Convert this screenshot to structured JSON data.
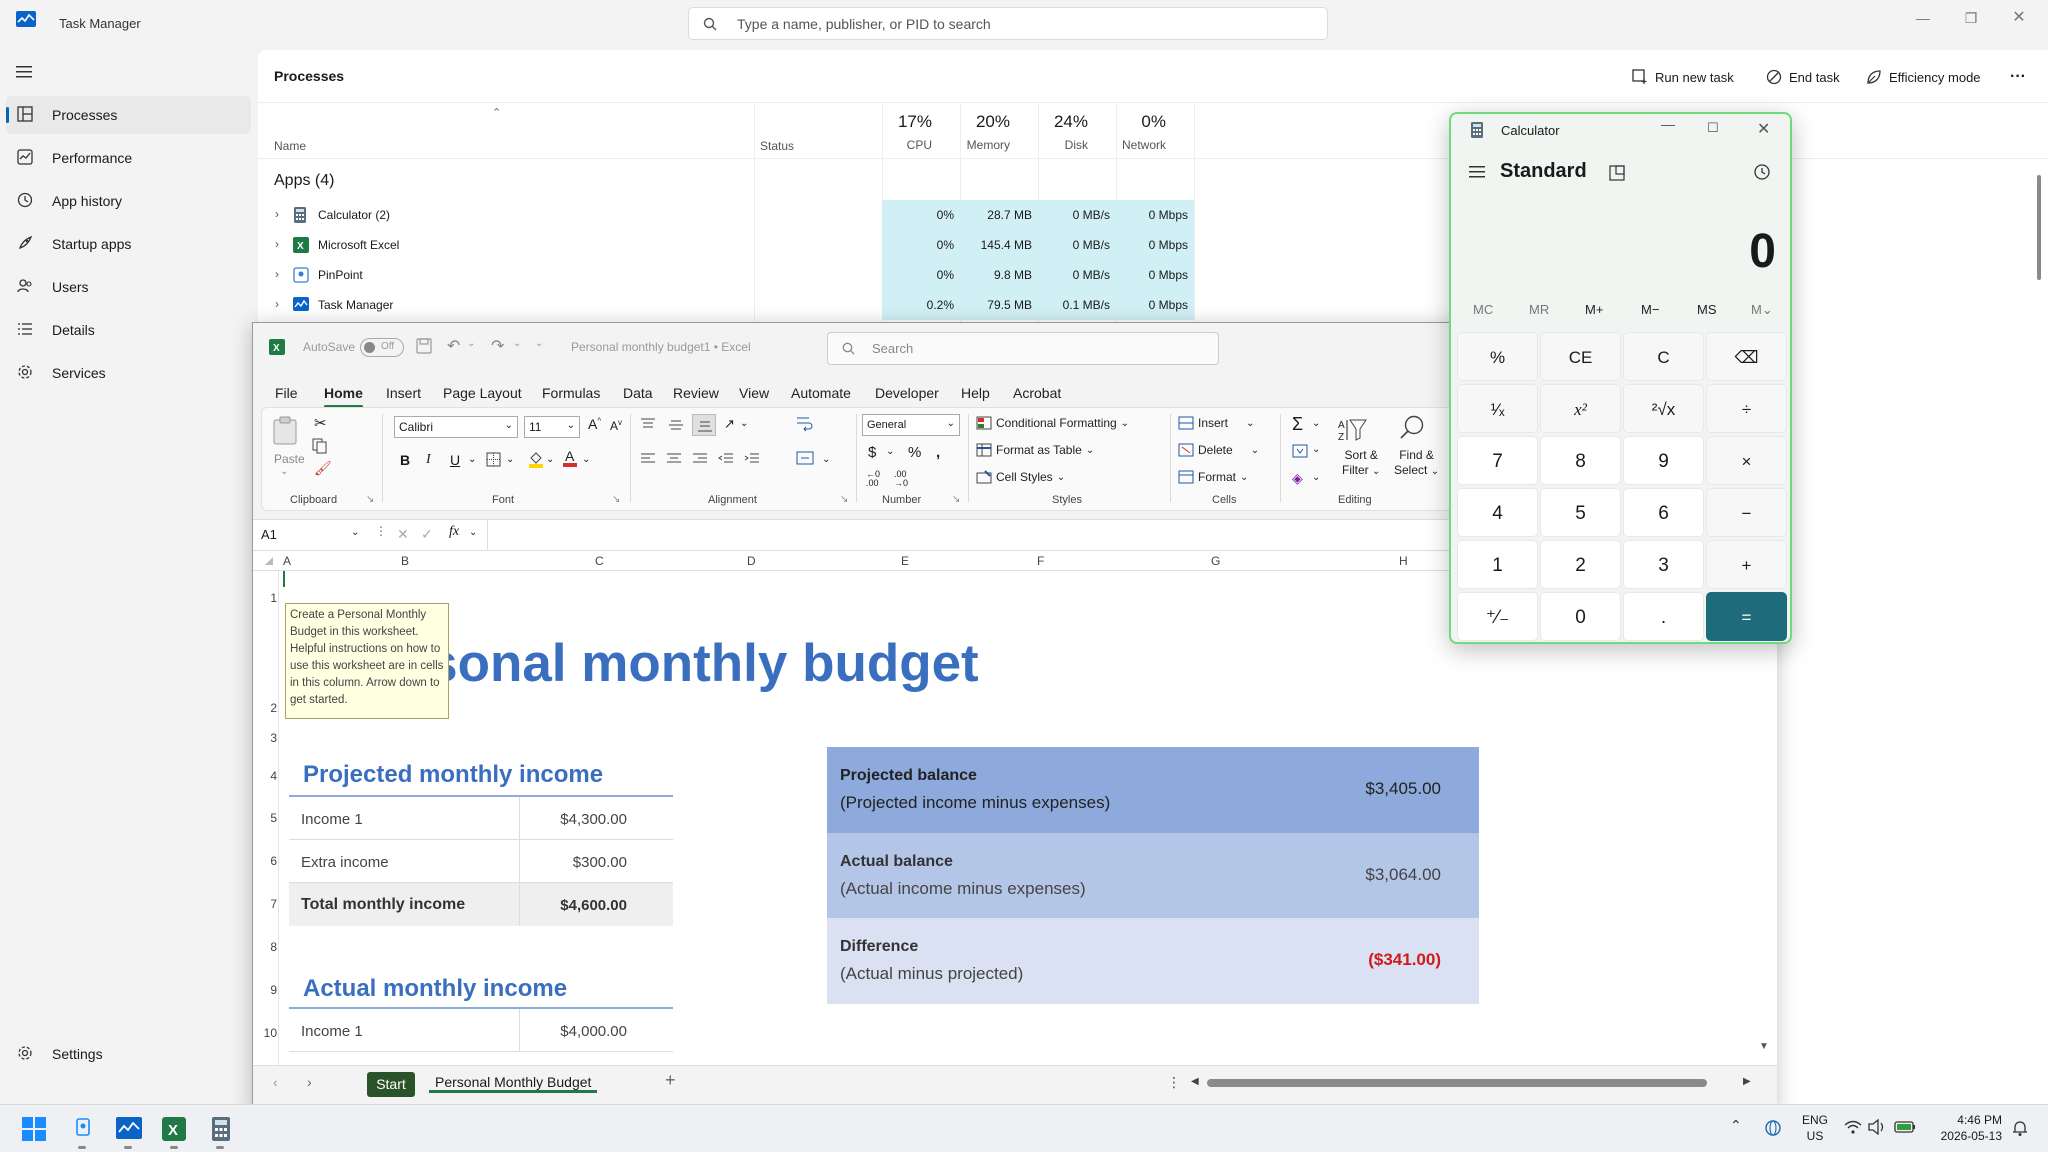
{
  "taskmanager": {
    "title": "Task Manager",
    "search_placeholder": "Type a name, publisher, or PID to search",
    "nav": [
      "Processes",
      "Performance",
      "App history",
      "Startup apps",
      "Users",
      "Details",
      "Services"
    ],
    "settings": "Settings",
    "page_title": "Processes",
    "toolbar": {
      "run": "Run new task",
      "end": "End task",
      "efficiency": "Efficiency mode",
      "more": "···"
    },
    "columns": {
      "name": "Name",
      "status": "Status",
      "cpu_pct": "17%",
      "cpu": "CPU",
      "mem_pct": "20%",
      "mem": "Memory",
      "disk_pct": "24%",
      "disk": "Disk",
      "net_pct": "0%",
      "net": "Network"
    },
    "group": "Apps (4)",
    "rows": [
      {
        "name": "Calculator (2)",
        "cpu": "0%",
        "mem": "28.7 MB",
        "disk": "0 MB/s",
        "net": "0 Mbps"
      },
      {
        "name": "Microsoft Excel",
        "cpu": "0%",
        "mem": "145.4 MB",
        "disk": "0 MB/s",
        "net": "0 Mbps"
      },
      {
        "name": "PinPoint",
        "cpu": "0%",
        "mem": "9.8 MB",
        "disk": "0 MB/s",
        "net": "0 Mbps"
      },
      {
        "name": "Task Manager",
        "cpu": "0.2%",
        "mem": "79.5 MB",
        "disk": "0.1 MB/s",
        "net": "0 Mbps"
      }
    ]
  },
  "excel": {
    "autosave": "AutoSave",
    "autosave_state": "Off",
    "doc_title": "Personal monthly budget1 • Excel",
    "search": "Search",
    "menu": [
      "File",
      "Home",
      "Insert",
      "Page Layout",
      "Formulas",
      "Data",
      "Review",
      "View",
      "Automate",
      "Developer",
      "Help",
      "Acrobat"
    ],
    "ribbon": {
      "paste": "Paste",
      "font_name": "Calibri",
      "font_size": "11",
      "number_format": "General",
      "cond_format": "Conditional Formatting",
      "format_table": "Format as Table",
      "cell_styles": "Cell Styles",
      "insert": "Insert",
      "delete": "Delete",
      "format": "Format",
      "sort": "Sort &",
      "filter": "Filter",
      "find": "Find &",
      "select": "Select",
      "groups": [
        "Clipboard",
        "Font",
        "Alignment",
        "Number",
        "Styles",
        "Cells",
        "Editing"
      ]
    },
    "namebox": "A1",
    "fx": "fx",
    "col_headers": [
      "A",
      "B",
      "C",
      "D",
      "E",
      "F",
      "G",
      "H"
    ],
    "row_numbers": [
      "1",
      "2",
      "3",
      "4",
      "5",
      "6",
      "7",
      "8",
      "9",
      "10"
    ],
    "tooltip": "Create a Personal Monthly Budget in this worksheet. Helpful instructions on how to use this worksheet are in cells in this column. Arrow down to get started.",
    "sheet_title": "ersonal monthly budget",
    "projected_heading": "Projected monthly income",
    "projected_rows": [
      {
        "label": "Income 1",
        "value": "$4,300.00"
      },
      {
        "label": "Extra income",
        "value": "$300.00"
      },
      {
        "label": "Total monthly income",
        "value": "$4,600.00"
      }
    ],
    "actual_heading": "Actual monthly income",
    "actual_rows": [
      {
        "label": "Income 1",
        "value": "$4,000.00"
      }
    ],
    "balance": [
      {
        "title": "Projected balance",
        "sub": "(Projected income minus expenses)",
        "value": "$3,405.00",
        "color": "#8ea9db"
      },
      {
        "title": "Actual balance",
        "sub": "(Actual income minus expenses)",
        "value": "$3,064.00",
        "color": "#b4c6e7"
      },
      {
        "title": "Difference",
        "sub": "(Actual minus projected)",
        "value": "($341.00)",
        "color": "#d9e1f2"
      }
    ],
    "tabs": {
      "start": "Start",
      "active": "Personal Monthly Budget"
    }
  },
  "calculator": {
    "title": "Calculator",
    "mode": "Standard",
    "display": "0",
    "memory": [
      "MC",
      "MR",
      "M+",
      "M−",
      "MS",
      "M⌄"
    ],
    "keys": [
      "%",
      "CE",
      "C",
      "⌫",
      "¹⁄ₓ",
      "x²",
      "²√x",
      "÷",
      "7",
      "8",
      "9",
      "×",
      "4",
      "5",
      "6",
      "−",
      "1",
      "2",
      "3",
      "+",
      "⁺⁄₋",
      "0",
      ".",
      "="
    ]
  },
  "taskbar": {
    "lang1": "ENG",
    "lang2": "US",
    "time": "4:46 PM",
    "date": "2026-05-13"
  }
}
